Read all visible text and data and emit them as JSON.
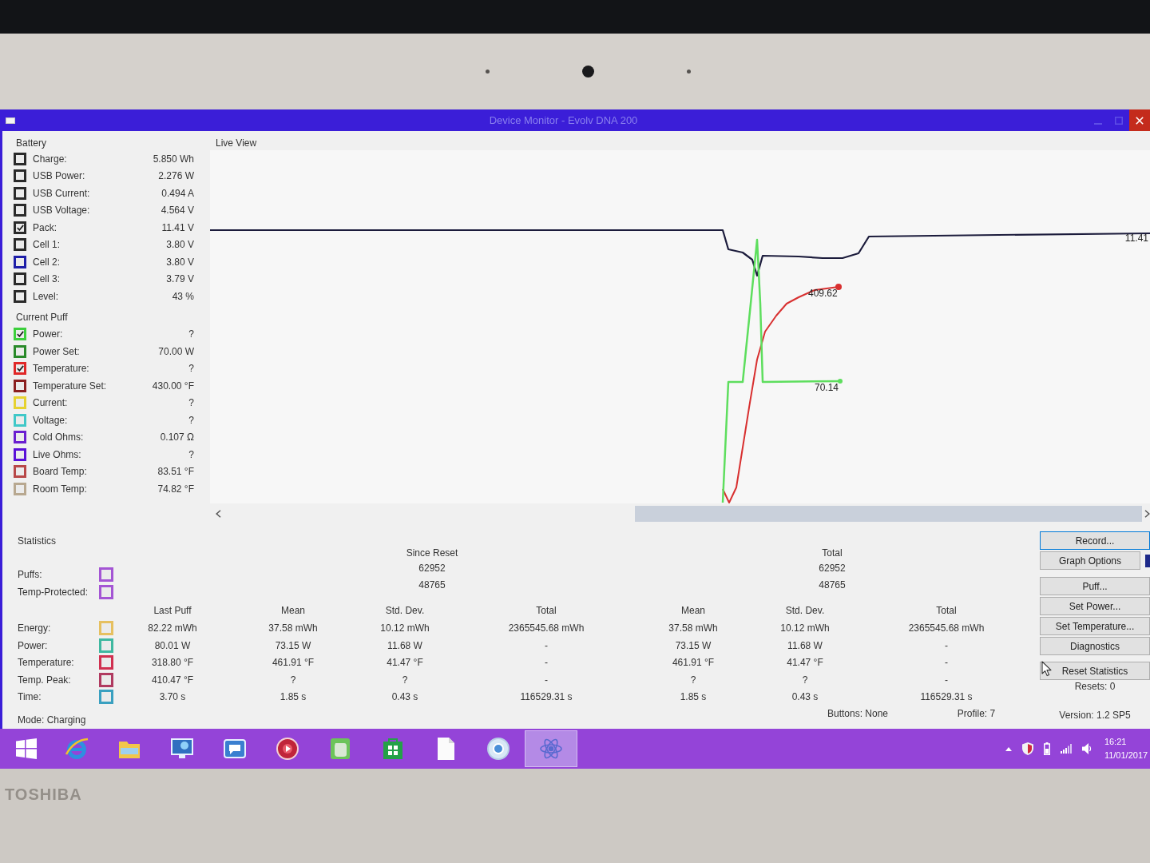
{
  "window": {
    "title": "Device Monitor - Evolv DNA 200"
  },
  "battery": {
    "title": "Battery",
    "items": [
      {
        "label": "Charge:",
        "value": "5.850 Wh",
        "checked": false,
        "color": "#2a2a2a"
      },
      {
        "label": "USB Power:",
        "value": "2.276 W",
        "checked": false,
        "color": "#2a2a2a"
      },
      {
        "label": "USB Current:",
        "value": "0.494 A",
        "checked": false,
        "color": "#2a2a2a"
      },
      {
        "label": "USB Voltage:",
        "value": "4.564 V",
        "checked": false,
        "color": "#2a2a2a"
      },
      {
        "label": "Pack:",
        "value": "11.41 V",
        "checked": true,
        "color": "#2a2a2a"
      },
      {
        "label": "Cell 1:",
        "value": "3.80 V",
        "checked": false,
        "color": "#2a2a2a"
      },
      {
        "label": "Cell 2:",
        "value": "3.80 V",
        "checked": false,
        "color": "#1e1ea8"
      },
      {
        "label": "Cell 3:",
        "value": "3.79 V",
        "checked": false,
        "color": "#2a2a2a"
      },
      {
        "label": "Level:",
        "value": "43 %",
        "checked": false,
        "color": "#2a2a2a"
      }
    ]
  },
  "current_puff": {
    "title": "Current Puff",
    "items": [
      {
        "label": "Power:",
        "value": "?",
        "checked": true,
        "color": "#3ccf3c"
      },
      {
        "label": "Power Set:",
        "value": "70.00 W",
        "checked": false,
        "color": "#2a8a2a"
      },
      {
        "label": "Temperature:",
        "value": "?",
        "checked": true,
        "color": "#e02828"
      },
      {
        "label": "Temperature Set:",
        "value": "430.00 °F",
        "checked": false,
        "color": "#8b2020"
      },
      {
        "label": "Current:",
        "value": "?",
        "checked": false,
        "color": "#e6d230"
      },
      {
        "label": "Voltage:",
        "value": "?",
        "checked": false,
        "color": "#40c8c8"
      },
      {
        "label": "Cold Ohms:",
        "value": "0.107 Ω",
        "checked": false,
        "color": "#6a1fd0"
      },
      {
        "label": "Live Ohms:",
        "value": "?",
        "checked": false,
        "color": "#5a10d8"
      },
      {
        "label": "Board Temp:",
        "value": "83.51 °F",
        "checked": false,
        "color": "#b84848"
      },
      {
        "label": "Room Temp:",
        "value": "74.82 °F",
        "checked": false,
        "color": "#b8a890"
      }
    ]
  },
  "live_view": {
    "title": "Live View",
    "series": [
      {
        "label": "11.41",
        "color": "#1c1c3c"
      },
      {
        "label": "409.62",
        "color": "#d83030"
      },
      {
        "label": "70.14",
        "color": "#5ede5e"
      }
    ]
  },
  "statistics": {
    "title": "Statistics",
    "counters": {
      "headers": [
        "Since Reset",
        "Total"
      ],
      "rows": [
        {
          "label": "Puffs:",
          "checked": false,
          "color": "#a455d4",
          "values": [
            "62952",
            "62952"
          ]
        },
        {
          "label": "Temp-Protected:",
          "checked": false,
          "color": "#a455d4",
          "values": [
            "48765",
            "48765"
          ]
        }
      ]
    },
    "table": {
      "columns": [
        "Last Puff",
        "Mean",
        "Std. Dev.",
        "Total",
        "Mean",
        "Std. Dev.",
        "Total"
      ],
      "rows": [
        {
          "label": "Energy:",
          "checked": false,
          "color": "#e6c060",
          "cells": [
            "82.22 mWh",
            "37.58 mWh",
            "10.12 mWh",
            "2365545.68 mWh",
            "37.58 mWh",
            "10.12 mWh",
            "2365545.68 mWh"
          ]
        },
        {
          "label": "Power:",
          "checked": false,
          "color": "#3fb8a0",
          "cells": [
            "80.01 W",
            "73.15 W",
            "11.68 W",
            "-",
            "73.15 W",
            "11.68 W",
            "-"
          ]
        },
        {
          "label": "Temperature:",
          "checked": false,
          "color": "#d03050",
          "cells": [
            "318.80 °F",
            "461.91 °F",
            "41.47 °F",
            "-",
            "461.91 °F",
            "41.47 °F",
            "-"
          ]
        },
        {
          "label": "Temp. Peak:",
          "checked": false,
          "color": "#b03a60",
          "cells": [
            "410.47 °F",
            "?",
            "?",
            "-",
            "?",
            "?",
            "-"
          ]
        },
        {
          "label": "Time:",
          "checked": false,
          "color": "#3aa0c0",
          "cells": [
            "3.70 s",
            "1.85 s",
            "0.43 s",
            "116529.31 s",
            "1.85 s",
            "0.43 s",
            "116529.31 s"
          ]
        }
      ]
    },
    "mode": "Mode: Charging",
    "buttons_state": "Buttons: None",
    "profile": "Profile: 7"
  },
  "actions": {
    "groups": [
      {
        "buttons": [
          {
            "label": "Record...",
            "kind": "plain",
            "focused": true
          },
          {
            "label": "Graph Options",
            "kind": "split",
            "focused": false
          }
        ]
      },
      {
        "buttons": [
          {
            "label": "Puff...",
            "kind": "plain",
            "focused": false
          },
          {
            "label": "Set Power...",
            "kind": "plain",
            "focused": false
          },
          {
            "label": "Set Temperature...",
            "kind": "plain",
            "focused": false
          },
          {
            "label": "Diagnostics",
            "kind": "plain",
            "focused": false
          }
        ]
      },
      {
        "buttons": [
          {
            "label": "Reset Statistics",
            "kind": "plain",
            "focused": false
          }
        ]
      }
    ],
    "resets": "Resets: 0",
    "version": "Version: 1.2 SP5"
  },
  "taskbar": {
    "apps": [
      {
        "selected": false
      },
      {
        "selected": false
      },
      {
        "selected": false
      },
      {
        "selected": false
      },
      {
        "selected": false
      },
      {
        "selected": false
      },
      {
        "selected": false
      },
      {
        "selected": false
      },
      {
        "selected": false
      },
      {
        "selected": true
      }
    ],
    "time": "16:21",
    "date": "11/01/2017"
  },
  "bezel": {
    "brand": "TOSHIBA"
  }
}
